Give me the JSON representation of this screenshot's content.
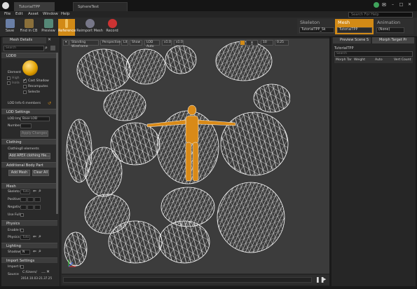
{
  "window": {
    "tabs": [
      "TutorialTPP Skeleton",
      "SphereTest"
    ],
    "controls": [
      "–",
      "□",
      "✕"
    ]
  },
  "menu": [
    "File",
    "Edit",
    "Asset",
    "Window",
    "Help"
  ],
  "search_help": {
    "placeholder": "Search For Help"
  },
  "toolbar": {
    "buttons": [
      {
        "label": "Save",
        "icon": "save-icon"
      },
      {
        "label": "Find in CB",
        "icon": "find-in-content-browser-icon"
      },
      {
        "label": "Preview",
        "icon": "preview-icon"
      },
      {
        "label": "Reference",
        "icon": "reference-pose-icon"
      },
      {
        "label": "Reimport Mesh",
        "icon": "reimport-icon"
      },
      {
        "label": "Record",
        "icon": "record-icon"
      }
    ],
    "active": "Reference"
  },
  "modes": [
    {
      "title": "Skeleton",
      "value": "TutorialTPP_Sk"
    },
    {
      "title": "Mesh",
      "value": "TutorialTPP"
    },
    {
      "title": "Animation",
      "value": "(None)"
    }
  ],
  "left": {
    "tab": "Mesh Details",
    "search_placeholder": "Search",
    "lod_header": "LOD0",
    "element_label": "Element",
    "element_options": [
      "High",
      "Isola",
      "Cast Shadow",
      "Recomputes",
      "Selecte"
    ],
    "lod_info_label": "LOD Info",
    "lod_info_value": "6 members",
    "lod_settings_header": "LOD Settings",
    "lod_import_label": "LOD Imp",
    "lod_import_value": "Base LOD",
    "number_label": "Number",
    "apply_changes": "Apply Changes",
    "clothing_header": "Clothing",
    "clothing_label": "Clothing",
    "clothing_value": "0 elements",
    "add_apex_btn": "Add APEX clothing file...",
    "additional_header": "Additional Body Part",
    "add_mesh_btn": "Add Mesh",
    "clear_all_btn": "Clear All",
    "mesh_header": "Mesh",
    "skeleton_label": "Skeleto",
    "skeleton_value": "Tuto",
    "positive_label": "Positive",
    "negative_label": "Negativ",
    "use_full_label": "Use Full",
    "physics_header": "Physics",
    "enable_label": "Enable I",
    "physics_label": "Physics",
    "physics_value": "Tuto",
    "lighting_header": "Lighting",
    "shadow_label": "Shadow",
    "shadow_value": "N",
    "import_header": "Import Settings",
    "import_label": "Import I",
    "source_label": "Source",
    "source_path": "C:/Users/",
    "source_date": "2014.10.03-21.37.25"
  },
  "viewport": {
    "toolbar": [
      "Standing Wireframe",
      "Perspective",
      "Lit",
      "Show",
      "LOD Auto",
      "x1.0",
      "x1.0"
    ],
    "right_values": [
      "10",
      "0.25"
    ]
  },
  "right": {
    "tabs": [
      "Preview Scene S",
      "Morph Target Pr"
    ],
    "mesh_name": "TutorialTPP",
    "search_placeholder": "Search",
    "columns": [
      "Morph Tar",
      "Weight",
      "Auto",
      "Vert Count"
    ]
  }
}
